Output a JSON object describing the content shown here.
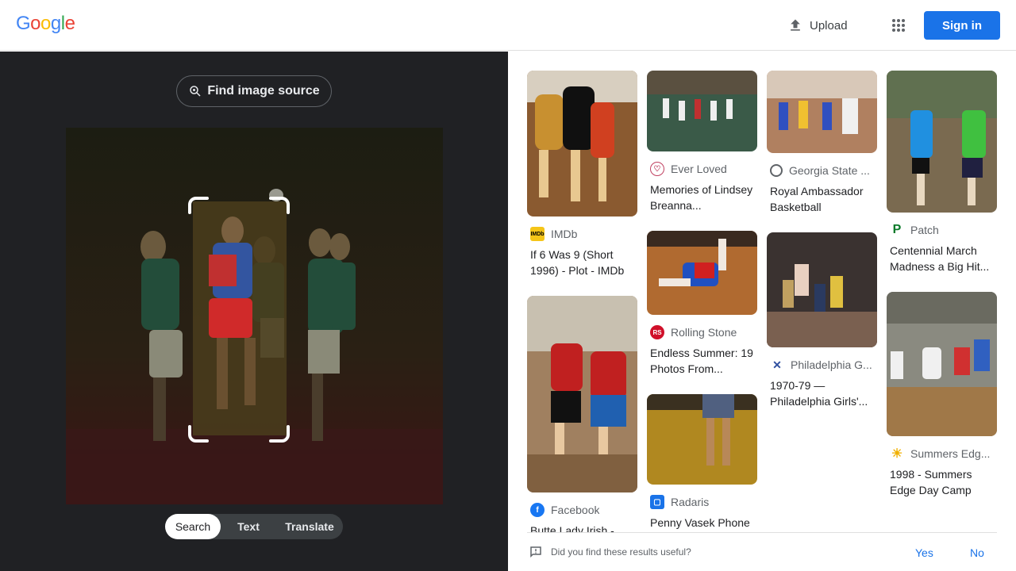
{
  "header": {
    "logo_letters": [
      "G",
      "o",
      "o",
      "g",
      "l",
      "e"
    ],
    "logo_colors": [
      "#4285F4",
      "#EA4335",
      "#FBBC05",
      "#4285F4",
      "#34A853",
      "#EA4335"
    ],
    "upload_label": "Upload",
    "signin_label": "Sign in"
  },
  "left": {
    "find_source_label": "Find image source",
    "modes": [
      "Search",
      "Text",
      "Translate"
    ],
    "active_mode": "Search"
  },
  "results": {
    "col1": [
      {
        "source": "IMDb",
        "title": "If 6 Was 9 (Short 1996) - Plot - IMDb"
      },
      {
        "source": "Facebook",
        "title": "Butte Lady Irish -"
      }
    ],
    "col2": [
      {
        "source": "Ever Loved",
        "title": "Memories of Lindsey Breanna..."
      },
      {
        "source": "Rolling Stone",
        "title": "Endless Summer: 19 Photos From..."
      },
      {
        "source": "Radaris",
        "title": "Penny Vasek Phone"
      }
    ],
    "col3": [
      {
        "source": "Georgia State ...",
        "title": "Royal Ambassador Basketball"
      },
      {
        "source": "Philadelphia G...",
        "title": "1970-79 — Philadelphia Girls'..."
      }
    ],
    "col4": [
      {
        "source": "Patch",
        "title": "Centennial March Madness a Big Hit..."
      },
      {
        "source": "Summers Edg...",
        "title": "1998 - Summers Edge Day Camp"
      }
    ]
  },
  "feedback": {
    "question": "Did you find these results useful?",
    "yes": "Yes",
    "no": "No"
  },
  "colors": {
    "accent": "#1a73e8",
    "dark_panel": "#202124"
  }
}
